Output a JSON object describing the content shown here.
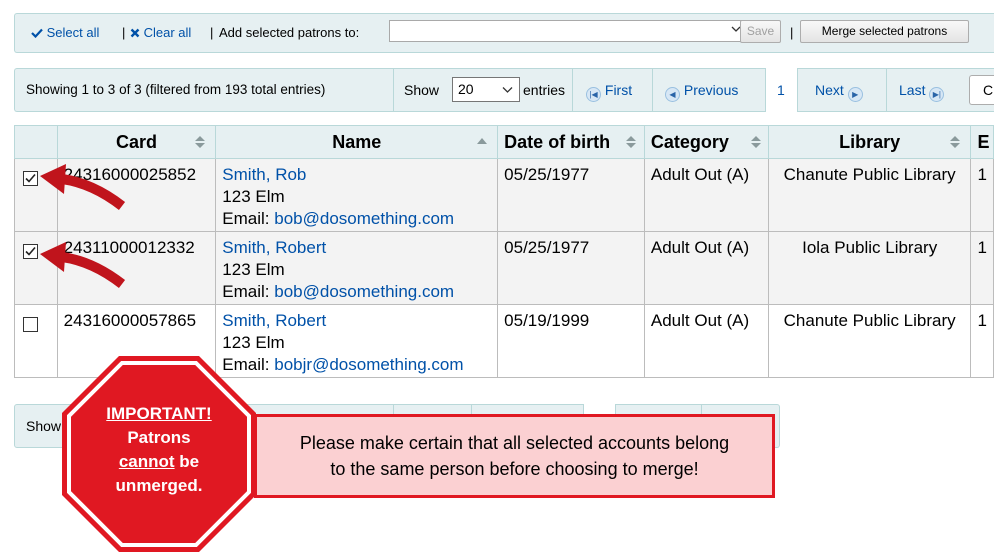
{
  "toolbar": {
    "select_all": "Select all",
    "clear_all": "Clear all",
    "add_label": "Add selected patrons to:",
    "add_select_value": "",
    "save_label": "Save",
    "merge_label": "Merge selected patrons",
    "select_all_icon": "check-icon",
    "clear_all_icon": "x-icon"
  },
  "pager": {
    "info": "Showing 1 to 3 of 3 (filtered from 193 total entries)",
    "show_label": "Show",
    "page_length": "20",
    "entries_label": "entries",
    "first": "First",
    "previous": "Previous",
    "current_page": "1",
    "next": "Next",
    "last": "Last",
    "columns_button": "C"
  },
  "table": {
    "headers": {
      "card": "Card",
      "name": "Name",
      "dob": "Date of birth",
      "category": "Category",
      "library": "Library",
      "extra": "E"
    },
    "rows": [
      {
        "checked": true,
        "card": "24316000025852",
        "name": "Smith, Rob",
        "address": "123 Elm",
        "email_label": "Email:",
        "email": "bob@dosomething.com",
        "dob": "05/25/1977",
        "category": "Adult Out (A)",
        "library": "Chanute Public Library",
        "extra": "1"
      },
      {
        "checked": true,
        "card": "24311000012332",
        "name": "Smith, Robert",
        "address": "123 Elm",
        "email_label": "Email:",
        "email": "bob@dosomething.com",
        "dob": "05/25/1977",
        "category": "Adult Out (A)",
        "library": "Iola Public Library",
        "extra": "1"
      },
      {
        "checked": false,
        "card": "24316000057865",
        "name": "Smith, Robert",
        "address": "123 Elm",
        "email_label": "Email:",
        "email": "bobjr@dosomething.com",
        "dob": "05/19/1999",
        "category": "Adult Out (A)",
        "library": "Chanute Public Library",
        "extra": "1"
      }
    ]
  },
  "bottom_pager": {
    "show_label": "Show"
  },
  "stop_sign": {
    "line1": "IMPORTANT!",
    "line2": "Patrons",
    "line3_a": "cannot",
    "line3_b": " be",
    "line4": "unmerged.",
    "color": "#e01822"
  },
  "warning": {
    "line1": "Please make certain that all selected accounts belong",
    "line2": "to the same person before choosing to merge!"
  },
  "colors": {
    "link": "#0051a8",
    "toolbar_bg": "#e6f0f2",
    "warning_bg": "#fbd0d2",
    "arrow": "#c0141c"
  }
}
